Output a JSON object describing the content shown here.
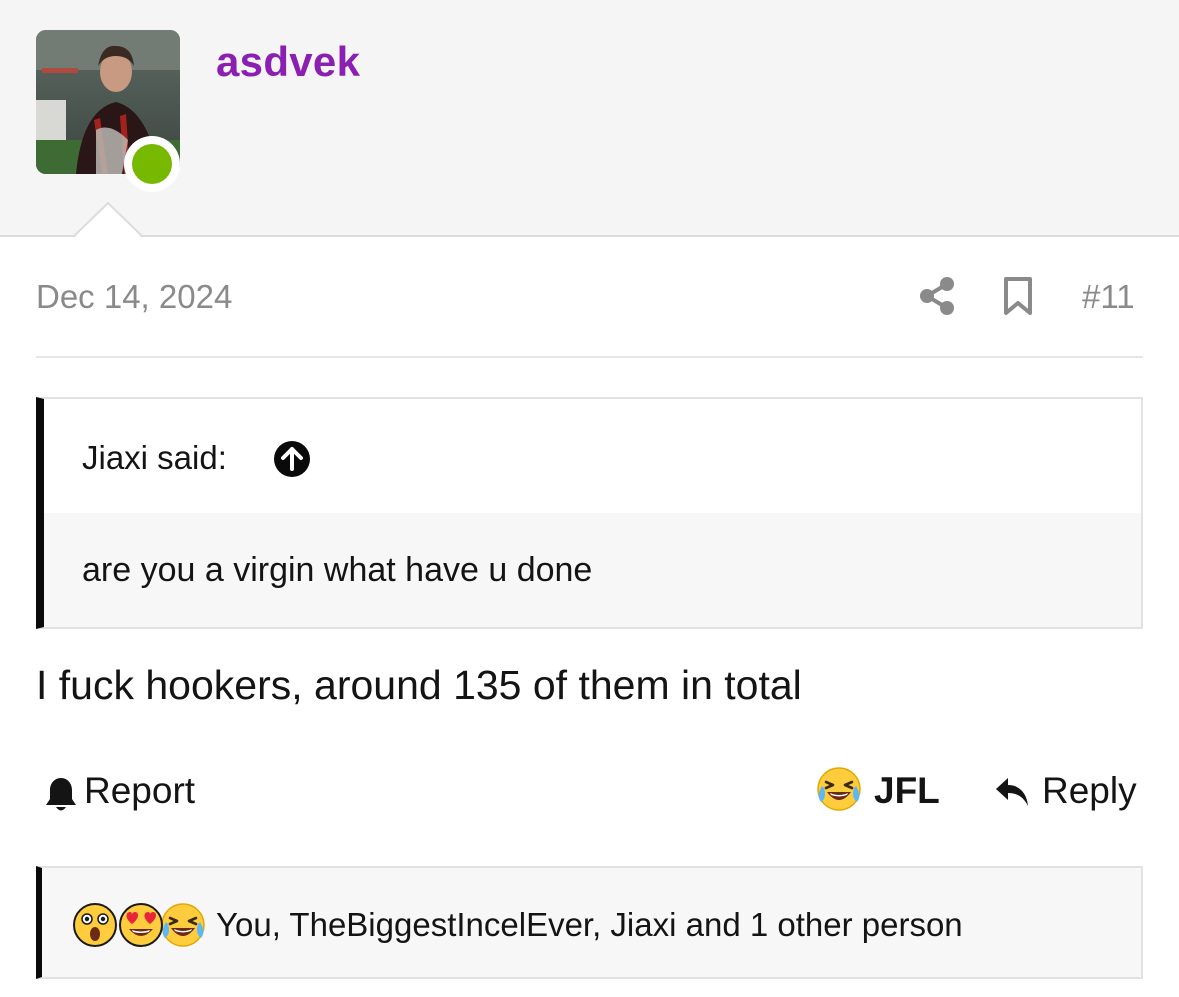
{
  "post": {
    "author": {
      "username": "asdvek",
      "username_color": "#8a1fb2",
      "online_status_color": "#77b800"
    },
    "date": "Dec 14, 2024",
    "post_number": "#11",
    "icons": {
      "share": "share-icon",
      "bookmark": "bookmark-icon"
    },
    "quote": {
      "author_line": "Jiaxi said:",
      "jump_icon": "arrow-up-circle-icon",
      "text": "are you a virgin what have u done"
    },
    "message": "I fuck hookers, around 135 of them in total",
    "actions": {
      "report_label": "Report",
      "reaction_label": "JFL",
      "reaction_emoji": "crying-laughing-emoji",
      "reply_label": "Reply"
    },
    "reactions_summary": {
      "emojis": [
        "astonished-emoji",
        "heart-eyes-emoji",
        "crying-laughing-emoji"
      ],
      "text": "You, TheBiggestIncelEver, Jiaxi and 1 other person"
    }
  }
}
